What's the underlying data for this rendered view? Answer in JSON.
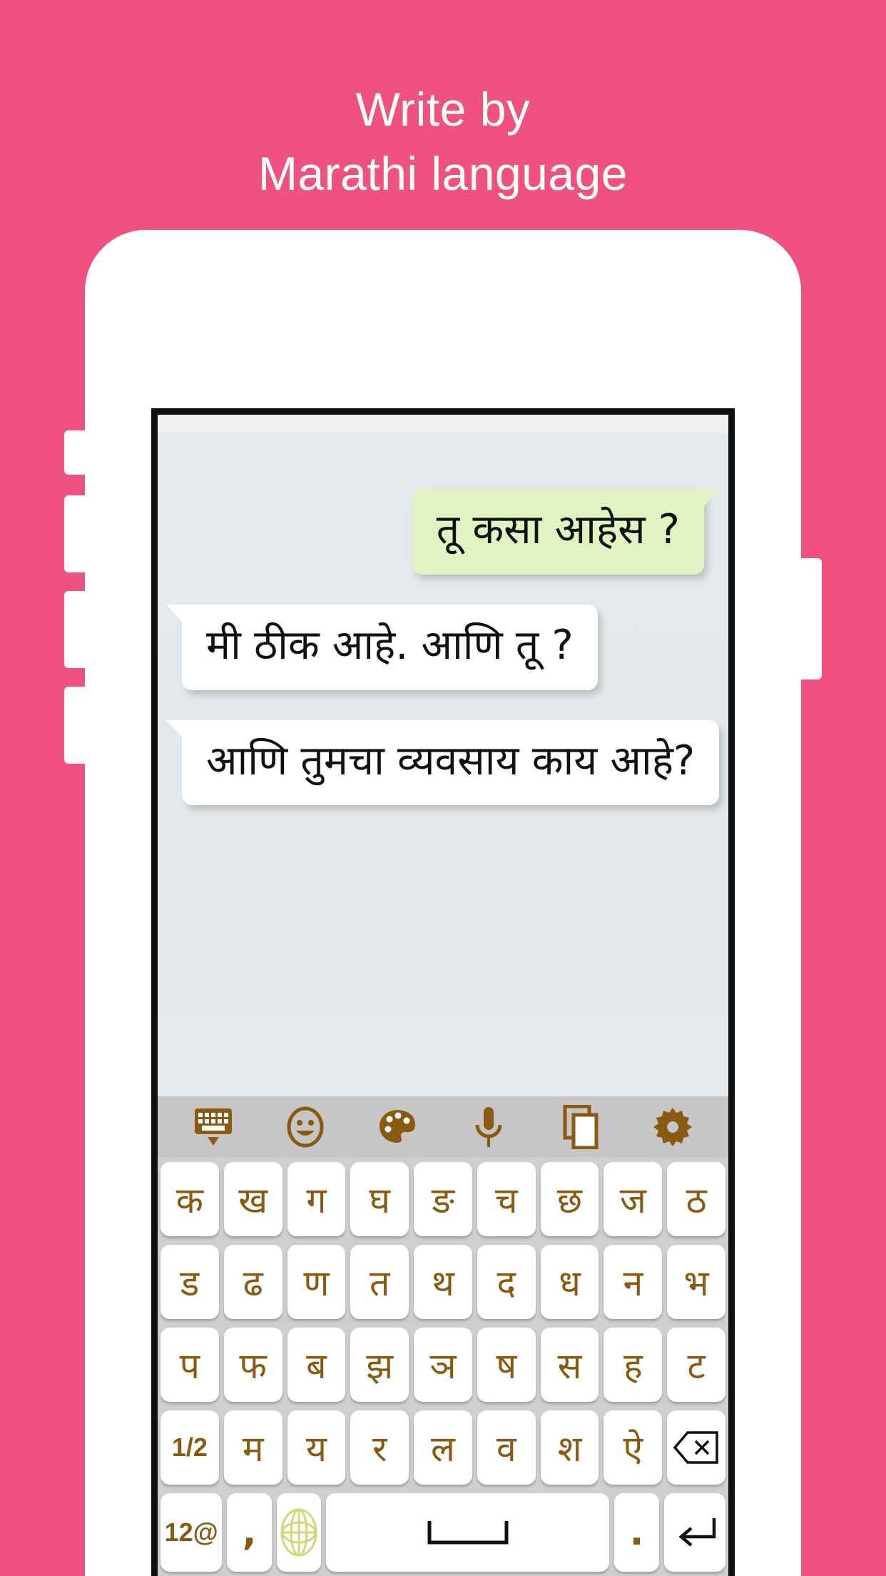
{
  "page": {
    "background_color": "#ef5181",
    "headline_lines": [
      "Write by",
      "Marathi language"
    ],
    "headline_color": "#ffffff"
  },
  "phone": {
    "frame_color": "#ffffff",
    "bezel_color": "#101010",
    "screen_background": "#e6eaec"
  },
  "chat": {
    "messages": [
      {
        "text": "तू कसा आहेस ?",
        "side": "out",
        "bubble_color": "#dff4c0"
      },
      {
        "text": "मी ठीक आहे. आणि तू ?",
        "side": "in",
        "bubble_color": "#ffffff"
      },
      {
        "text": "आणि तुमचा व्यवसाय काय आहे?",
        "side": "in",
        "bubble_color": "#ffffff"
      }
    ]
  },
  "keyboard": {
    "accent_color": "#8a5a11",
    "key_color": "#ffffff",
    "background_color": "#cfcfcf",
    "toolbar_background": "#c6c6c6",
    "toolbar": [
      {
        "name": "hide-keyboard-icon",
        "label": "keyboard"
      },
      {
        "name": "emoji-icon",
        "label": "emoji"
      },
      {
        "name": "theme-palette-icon",
        "label": "theme"
      },
      {
        "name": "microphone-icon",
        "label": "voice"
      },
      {
        "name": "clipboard-icon",
        "label": "clipboard"
      },
      {
        "name": "settings-gear-icon",
        "label": "settings"
      }
    ],
    "rows": [
      {
        "keys": [
          "क",
          "ख",
          "ग",
          "घ",
          "ङ",
          "च",
          "छ",
          "ज",
          "ठ"
        ]
      },
      {
        "keys": [
          "ड",
          "ढ",
          "ण",
          "त",
          "थ",
          "द",
          "ध",
          "न",
          "भ"
        ]
      },
      {
        "keys": [
          "प",
          "फ",
          "ब",
          "झ",
          "ञ",
          "ष",
          "स",
          "ह",
          "ट"
        ]
      },
      {
        "keys": [
          "1/2",
          "म",
          "य",
          "र",
          "ल",
          "व",
          "श",
          "ऐ",
          "backspace"
        ]
      },
      {
        "keys": [
          "12@",
          ",",
          "globe",
          "space",
          ".",
          "enter"
        ]
      }
    ],
    "labels": {
      "page_toggle": "1/2",
      "symbols": "12@",
      "comma": ",",
      "period": ".",
      "backspace": "backspace-key",
      "enter": "enter-key",
      "space": "space-key",
      "globe": "language-globe-key"
    }
  }
}
